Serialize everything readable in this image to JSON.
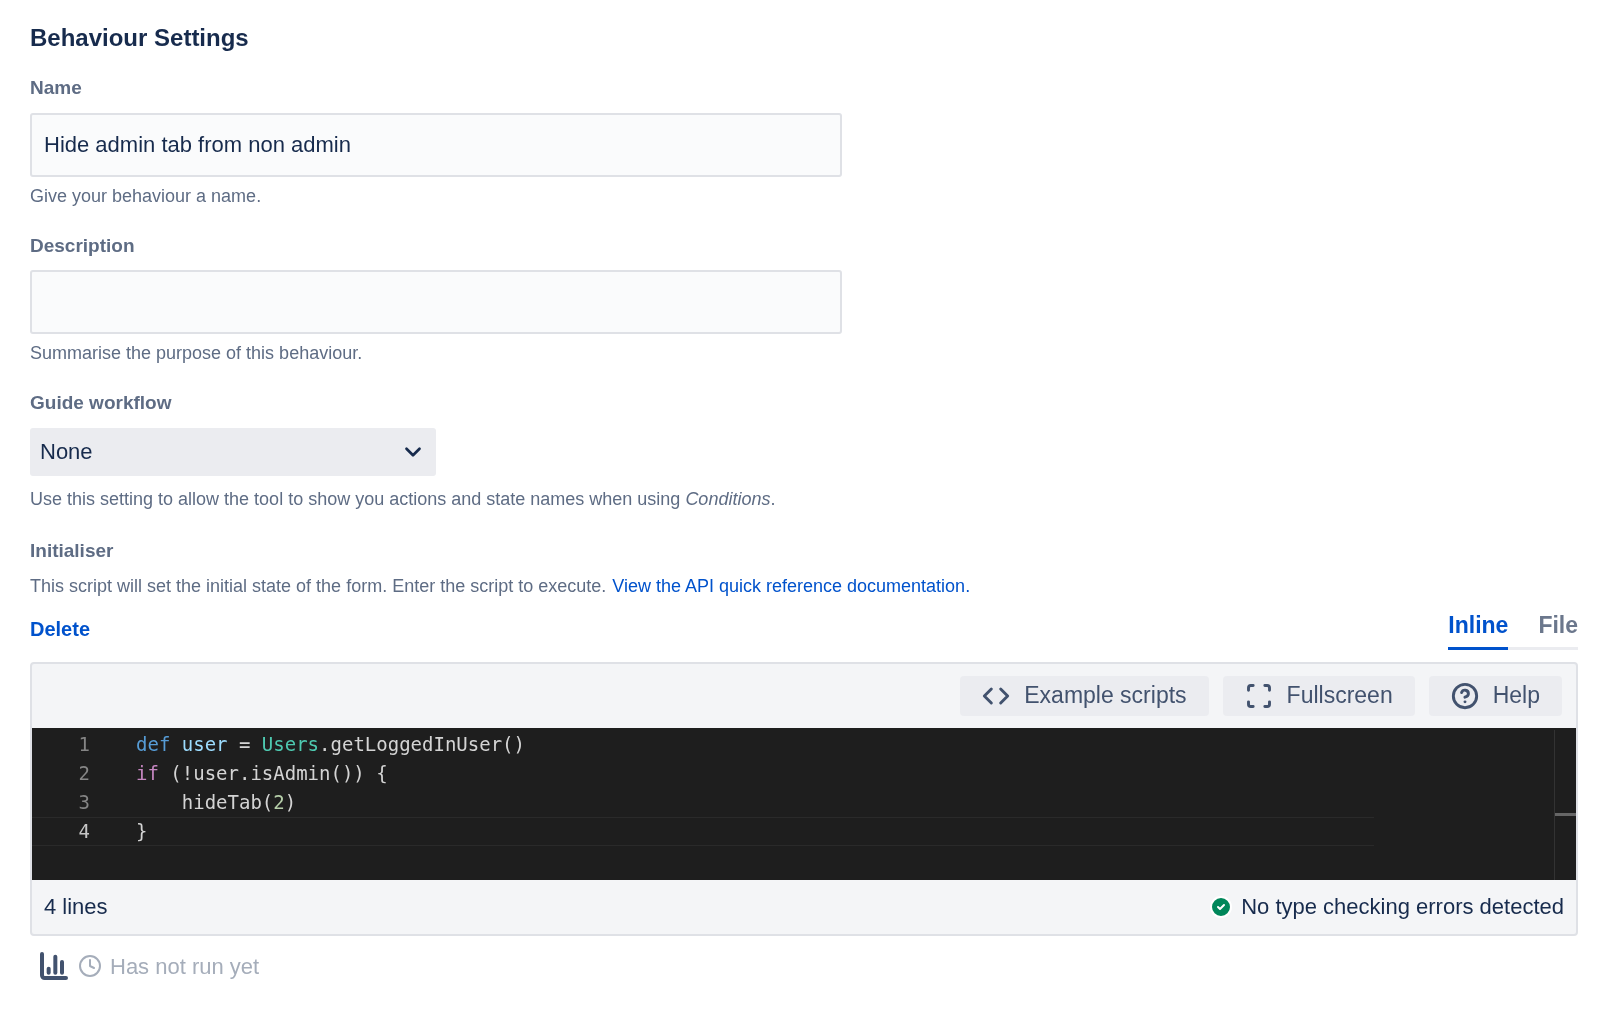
{
  "heading": "Behaviour Settings",
  "name_field": {
    "label": "Name",
    "value": "Hide admin tab from non admin",
    "help": "Give your behaviour a name."
  },
  "description_field": {
    "label": "Description",
    "help": "Summarise the purpose of this behaviour."
  },
  "guide_workflow": {
    "label": "Guide workflow",
    "value": "None",
    "help": "Use this setting to allow the tool to show you actions and state names when using *Conditions*."
  },
  "initialiser": {
    "label": "Initialiser",
    "help": "This script will set the initial state of the form. Enter the script to execute.",
    "link": "View the API quick reference documentation."
  },
  "delete_link": "Delete",
  "tabs": [
    {
      "label": "Inline",
      "selected": true
    },
    {
      "label": "File",
      "selected": false
    }
  ],
  "toolbar": [
    {
      "label": "Example scripts",
      "kind": "code"
    },
    {
      "label": "Fullscreen",
      "kind": "fullscreen"
    },
    {
      "label": "Help",
      "kind": "help"
    }
  ],
  "code": [
    {
      "number": "1",
      "active": false,
      "tokens": [
        {
          "text": "def",
          "kind": "keyword"
        },
        {
          "text": " user",
          "kind": "variable"
        },
        {
          "text": " = ",
          "kind": "plain"
        },
        {
          "text": "Users",
          "kind": "type"
        },
        {
          "text": ".getLoggedInUser()",
          "kind": "plain"
        }
      ]
    },
    {
      "number": "2",
      "active": false,
      "tokens": [
        {
          "text": "if",
          "kind": "control"
        },
        {
          "text": " (!user.isAdmin()) {",
          "kind": "plain"
        }
      ]
    },
    {
      "number": "3",
      "active": false,
      "tokens": [
        {
          "text": "    hideTab(",
          "kind": "plain"
        },
        {
          "text": "2",
          "kind": "number"
        },
        {
          "text": ")",
          "kind": "plain"
        }
      ]
    },
    {
      "number": "4",
      "active": true,
      "tokens": [
        {
          "text": "}",
          "kind": "plain"
        }
      ]
    }
  ],
  "status": {
    "lines": "4 lines",
    "check": "No type checking errors detected"
  },
  "run_status": "Has not run yet"
}
